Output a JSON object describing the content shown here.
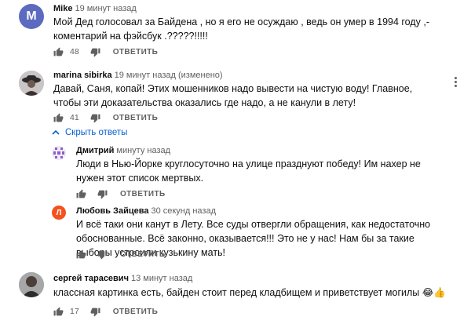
{
  "comments": [
    {
      "author": "Mike",
      "time": "19 минут назад",
      "avatar_letter": "M",
      "avatar_color": "#5c6bc0",
      "text": "Мой Дед голосовал за Байдена , но я его не осуждаю , ведь он умер в 1994 году ,- коментарий на фэйсбук .?????!!!!!",
      "likes": "48",
      "reply_label": "ОТВЕТИТЬ"
    },
    {
      "author": "marina sibirka",
      "time": "19 минут назад (изменено)",
      "text": "Давай, Саня, копай! Этих мошенников надо вывести на чистую воду! Главное, чтобы эти доказательства оказались где надо, а не канули в лету!",
      "likes": "41",
      "reply_label": "ОТВЕТИТЬ",
      "hide_replies_label": "Скрыть ответы",
      "replies": [
        {
          "author": "Дмитрий",
          "time": "минуту назад",
          "text": "Люди в Нью-Йорке круглосуточно на улице празднуют победу! Им нахер не нужен этот список мертвых.",
          "reply_label": "ОТВЕТИТЬ"
        },
        {
          "author": "Любовь Зайцева",
          "time": "30 секунд назад",
          "avatar_letter": "Л",
          "avatar_color": "#f4511e",
          "text": "И всё таки они канут в Лету. Все суды отвергли обращения, как недостаточно обоснованные. Всё законно, оказывается!!! Это не у нас! Нам бы за такие выборы устроили кузькину мать!",
          "reply_label": "ОТВЕТИТЬ"
        }
      ]
    },
    {
      "author": "сергей тарасевич",
      "time": "13 минут назад",
      "text": "классная картинка есть, байден стоит перед кладбищем и приветствует могилы",
      "emoji": "😂👍",
      "likes": "17",
      "reply_label": "ОТВЕТИТЬ"
    }
  ]
}
